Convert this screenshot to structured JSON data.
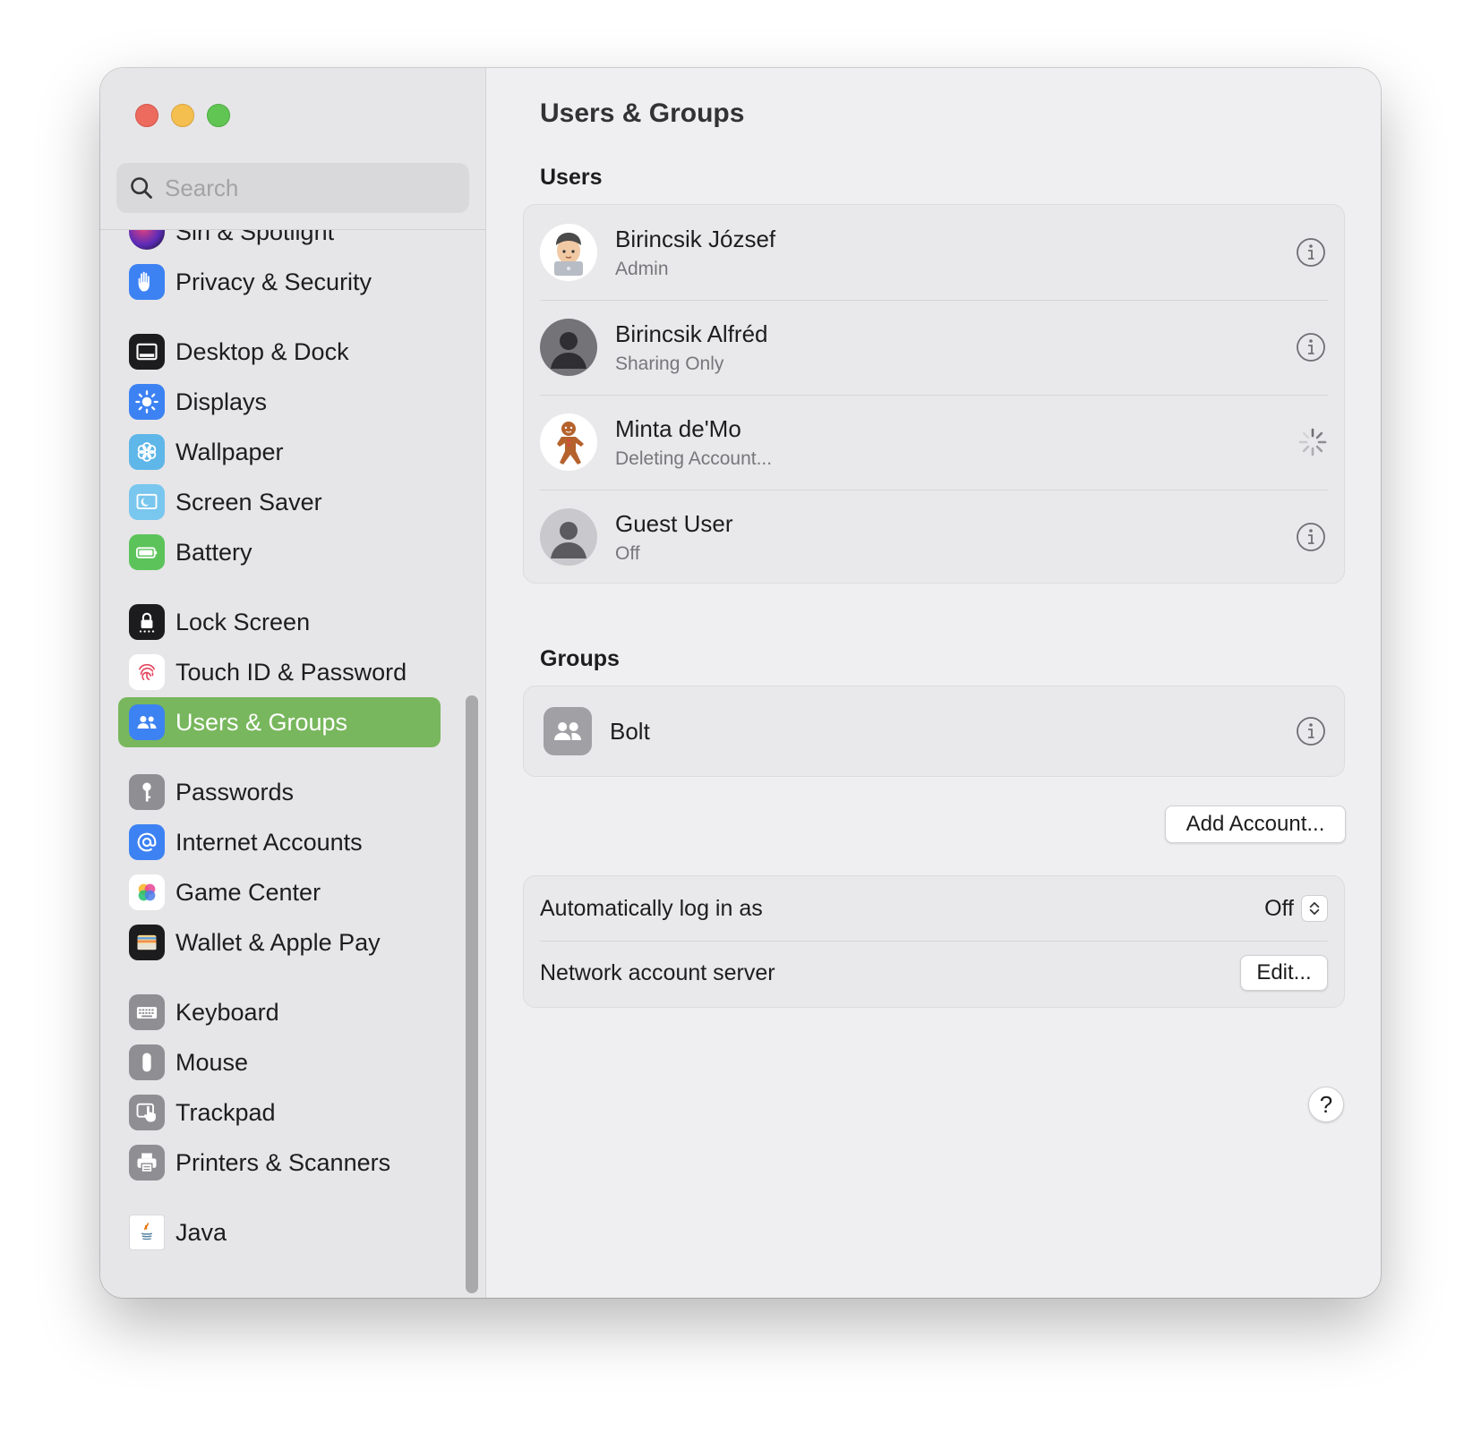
{
  "window": {
    "controls": [
      "close",
      "minimize",
      "maximize"
    ],
    "colors": {
      "close": "#ec6a5e",
      "minimize": "#f4bf4f",
      "maximize": "#61c554",
      "accent": "#78b75d"
    }
  },
  "sidebar": {
    "search_placeholder": "Search",
    "items": [
      {
        "label": "Siri & Spotlight",
        "icon": "siri-icon"
      },
      {
        "label": "Privacy & Security",
        "icon": "hand-icon"
      },
      {
        "label": "Desktop & Dock",
        "icon": "dock-icon"
      },
      {
        "label": "Displays",
        "icon": "sun-icon"
      },
      {
        "label": "Wallpaper",
        "icon": "flower-icon"
      },
      {
        "label": "Screen Saver",
        "icon": "screen-saver-icon"
      },
      {
        "label": "Battery",
        "icon": "battery-icon"
      },
      {
        "label": "Lock Screen",
        "icon": "lock-icon"
      },
      {
        "label": "Touch ID & Password",
        "icon": "fingerprint-icon"
      },
      {
        "label": "Users & Groups",
        "icon": "users-icon",
        "selected": true
      },
      {
        "label": "Passwords",
        "icon": "key-icon"
      },
      {
        "label": "Internet Accounts",
        "icon": "at-icon"
      },
      {
        "label": "Game Center",
        "icon": "game-center-icon"
      },
      {
        "label": "Wallet & Apple Pay",
        "icon": "wallet-icon"
      },
      {
        "label": "Keyboard",
        "icon": "keyboard-icon"
      },
      {
        "label": "Mouse",
        "icon": "mouse-icon"
      },
      {
        "label": "Trackpad",
        "icon": "trackpad-icon"
      },
      {
        "label": "Printers & Scanners",
        "icon": "printer-icon"
      },
      {
        "label": "Java",
        "icon": "java-icon"
      }
    ]
  },
  "main": {
    "title": "Users & Groups",
    "users_label": "Users",
    "users": [
      {
        "name": "Birincsik József",
        "role": "Admin",
        "avatar": "memoji-avatar",
        "action": "info"
      },
      {
        "name": "Birincsik Alfréd",
        "role": "Sharing Only",
        "avatar": "dark-person-avatar",
        "action": "info"
      },
      {
        "name": "Minta de'Mo",
        "role": "Deleting Account...",
        "avatar": "gingerbread-avatar",
        "action": "spinner"
      },
      {
        "name": "Guest User",
        "role": "Off",
        "avatar": "light-person-avatar",
        "action": "info"
      }
    ],
    "groups_label": "Groups",
    "groups": [
      {
        "name": "Bolt",
        "avatar": "group-avatar"
      }
    ],
    "add_account_label": "Add Account...",
    "auto_login": {
      "label": "Automatically log in as",
      "value": "Off"
    },
    "network_server": {
      "label": "Network account server",
      "button": "Edit..."
    },
    "help_label": "?"
  }
}
